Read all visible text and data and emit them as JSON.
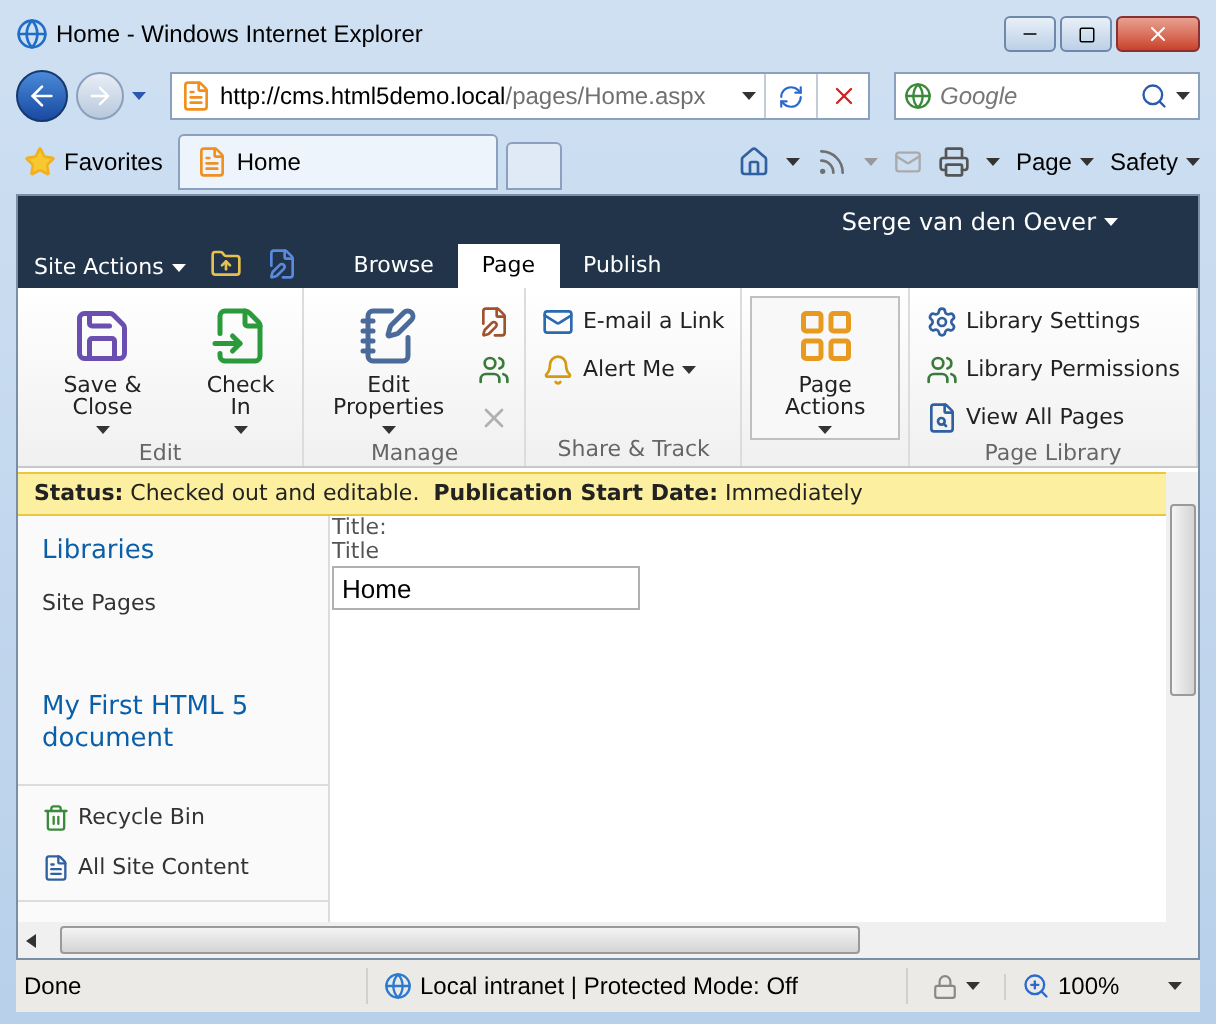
{
  "window": {
    "title": "Home - Windows Internet Explorer"
  },
  "address_bar": {
    "host": "http://cms.html5demo.local",
    "path": "/pages/Home.aspx"
  },
  "search": {
    "placeholder": "Google"
  },
  "favorites": "Favorites",
  "tabs": [
    {
      "label": "Home",
      "selected": true
    }
  ],
  "command_bar": [
    "Page",
    "Safety"
  ],
  "site_actions": "Site Actions",
  "ribbon_tabs": [
    {
      "label": "Browse",
      "selected": false
    },
    {
      "label": "Page",
      "selected": true
    },
    {
      "label": "Publish",
      "selected": false
    }
  ],
  "user": "Serge van den Oever",
  "ribbon_groups": [
    {
      "label": "Edit",
      "buttons": [
        {
          "kind": "large",
          "label": "Save & Close",
          "dropdown": true,
          "disabled": false
        },
        {
          "kind": "large",
          "label": "Check In",
          "dropdown": true,
          "disabled": false
        }
      ]
    },
    {
      "label": "Manage",
      "buttons": [
        {
          "kind": "large",
          "label": "Edit Properties",
          "dropdown": true,
          "disabled": false
        },
        {
          "kind": "icon",
          "dropdown": false,
          "disabled": false
        },
        {
          "kind": "icon",
          "dropdown": false,
          "disabled": false
        },
        {
          "kind": "icon",
          "dropdown": false,
          "disabled": true
        }
      ]
    },
    {
      "label": "Share & Track",
      "buttons": [
        {
          "kind": "small",
          "label": "E-mail a Link",
          "dropdown": false,
          "disabled": false
        },
        {
          "kind": "small",
          "label": "Alert Me",
          "dropdown": true,
          "disabled": false
        }
      ]
    },
    {
      "buttons": [
        {
          "kind": "large",
          "label": "Page Actions",
          "dropdown": true,
          "disabled": false,
          "selected": true
        }
      ]
    },
    {
      "label": "Page Library",
      "buttons": [
        {
          "kind": "small",
          "label": "Library Settings",
          "dropdown": false,
          "disabled": false
        },
        {
          "kind": "small",
          "label": "Library Permissions",
          "dropdown": false,
          "disabled": false
        },
        {
          "kind": "small",
          "label": "View All Pages",
          "dropdown": false,
          "disabled": false
        }
      ]
    }
  ],
  "status": "**Status:** Checked out and editable.  **Publication Start Date:** Immediately",
  "left_nav": {
    "heading": "Libraries",
    "items": [
      {
        "kind": "plain",
        "label": "Site Pages"
      },
      {
        "kind": "link",
        "label": "My First HTML 5 document"
      }
    ],
    "footer": [
      "Recycle Bin",
      "All Site Content"
    ]
  },
  "form": {
    "label": "Title:",
    "field_label": "Title",
    "value": "Home"
  },
  "status_bar": {
    "text": "Done",
    "zone": "Local intranet | Protected Mode: Off",
    "zoom": "100%"
  }
}
